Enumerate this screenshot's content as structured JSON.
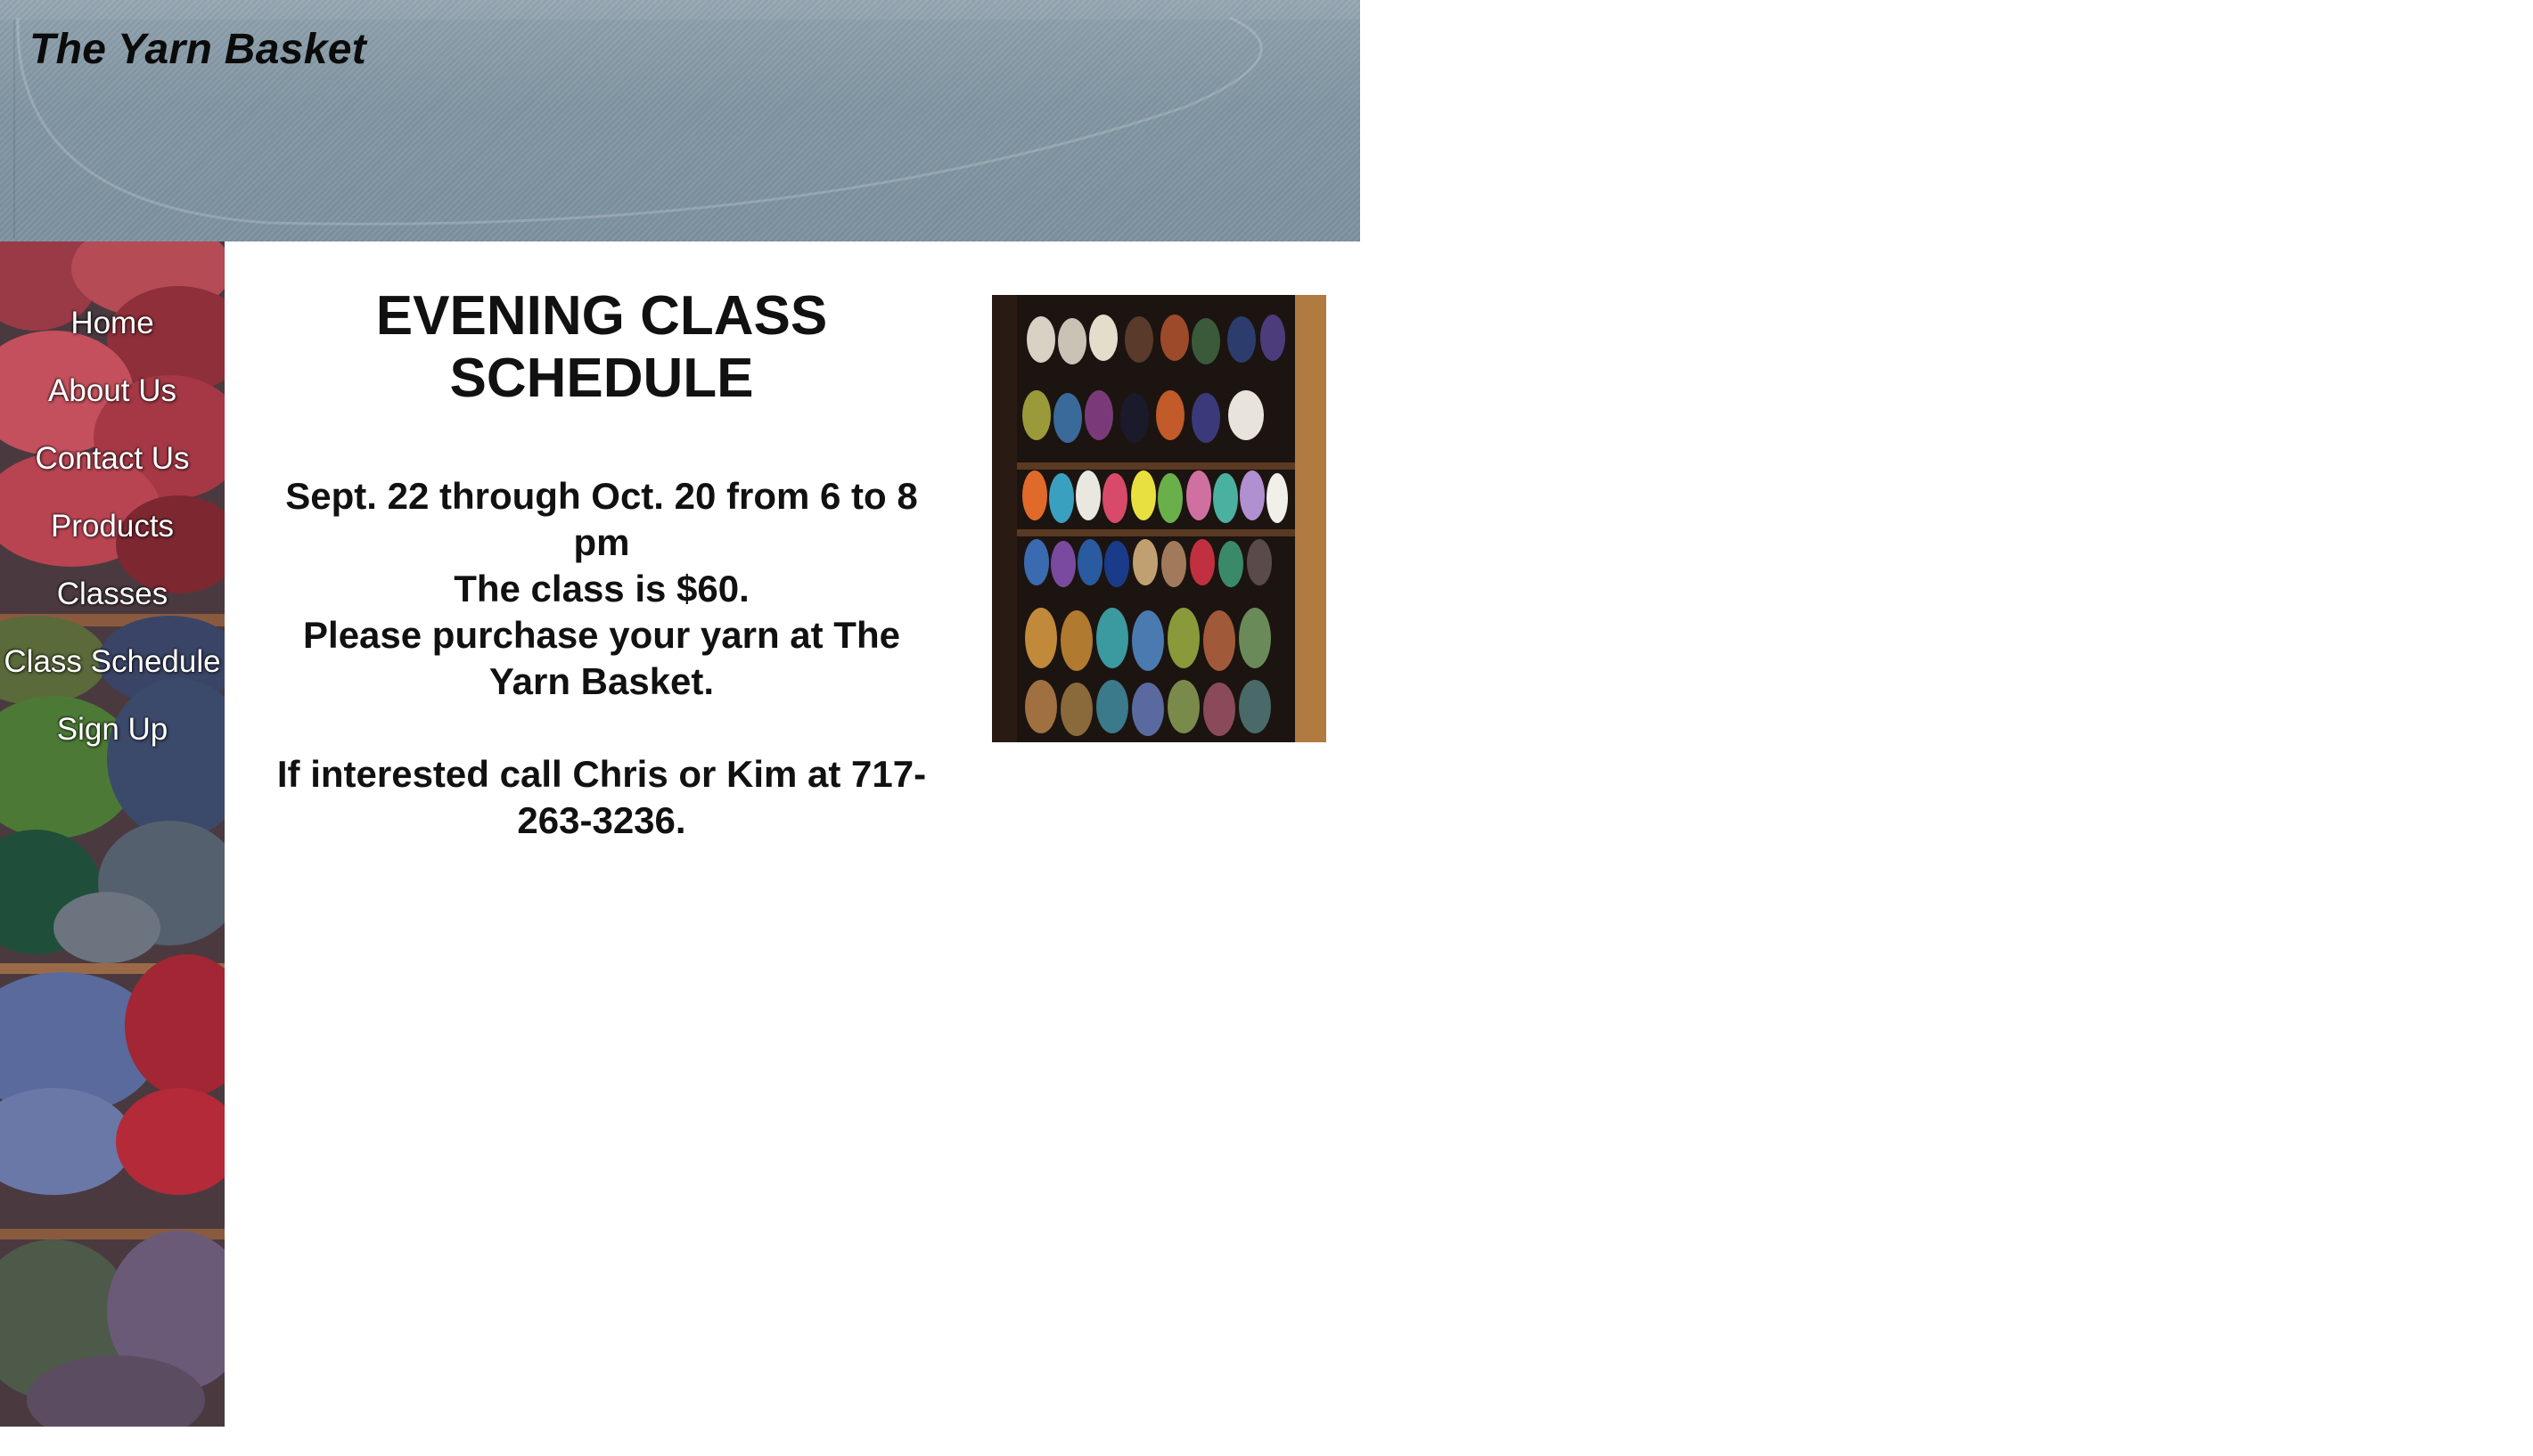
{
  "header": {
    "site_title": "The Yarn Basket"
  },
  "sidebar": {
    "nav_items": [
      {
        "label": "Home"
      },
      {
        "label": "About Us"
      },
      {
        "label": "Contact Us"
      },
      {
        "label": "Products"
      },
      {
        "label": "Classes"
      },
      {
        "label": "Class Schedule"
      },
      {
        "label": "Sign Up"
      }
    ]
  },
  "main": {
    "title": "EVENING CLASS SCHEDULE",
    "dates": "Sept. 22 through Oct. 20 from 6 to 8 pm",
    "price": "The class is $60.",
    "purchase_note": "Please purchase your yarn at The Yarn Basket.",
    "contact": "If interested call Chris or Kim at 717-263-3236."
  },
  "colors": {
    "header_bg": "#8196a3",
    "nav_text": "#ffffff",
    "body_text": "#111111"
  }
}
